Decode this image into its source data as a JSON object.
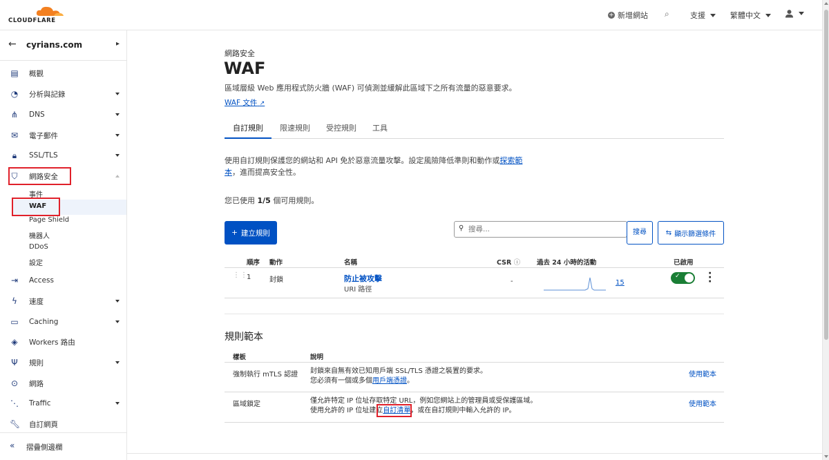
{
  "brand": {
    "logo_text": "CLOUDFLARE",
    "accent": "#f38020",
    "link_color": "#0051c3",
    "toggle_on": "#1a7e35"
  },
  "topbar": {
    "add_site": "新增網站",
    "support": "支援",
    "language": "繁體中文"
  },
  "sidebar": {
    "domain": "cyrians.com",
    "items": [
      {
        "label": "概觀",
        "icon": "document-icon"
      },
      {
        "label": "分析與記錄",
        "icon": "analytics-icon"
      },
      {
        "label": "DNS",
        "icon": "network-icon"
      },
      {
        "label": "電子郵件",
        "icon": "email-icon"
      },
      {
        "label": "SSL/TLS",
        "icon": "lock-icon"
      },
      {
        "label": "網路安全",
        "icon": "shield-icon"
      },
      {
        "label": "Access",
        "icon": "access-icon"
      },
      {
        "label": "速度",
        "icon": "bolt-icon"
      },
      {
        "label": "Caching",
        "icon": "drive-icon"
      },
      {
        "label": "Workers 路由",
        "icon": "workers-icon"
      },
      {
        "label": "規則",
        "icon": "rules-icon"
      },
      {
        "label": "網路",
        "icon": "location-icon"
      },
      {
        "label": "Traffic",
        "icon": "traffic-icon"
      },
      {
        "label": "自訂網頁",
        "icon": "wrench-icon"
      }
    ],
    "security_sub": [
      "事件",
      "WAF",
      "Page Shield",
      "機器人",
      "DDoS",
      "設定"
    ],
    "collapse": "摺疊側邊欄"
  },
  "page": {
    "eyebrow": "網路安全",
    "title": "WAF",
    "description": "區域層級 Web 應用程式防火牆 (WAF) 可偵測並緩解此區域下之所有流量的惡意要求。",
    "doc_link": "WAF 文件",
    "tabs": [
      "自訂規則",
      "限速規則",
      "受控規則",
      "工具"
    ],
    "intro_text": "使用自訂規則保護您的網站和 API 免於惡意流量攻擊。設定風險降低準則和動作或",
    "intro_link": "探索範本",
    "intro_suffix": "，進而提高安全性。",
    "usage_prefix": "您已使用",
    "usage_count": "1/5",
    "usage_suffix": "個可用規則。",
    "create_button": "建立規則",
    "search_placeholder": "搜尋...",
    "search_button": "搜尋",
    "filter_button": "顯示篩選條件"
  },
  "rules_table": {
    "headers": {
      "order": "順序",
      "action": "動作",
      "name": "名稱",
      "csr": "CSR",
      "activity": "過去 24 小時的活動",
      "enabled": "已啟用"
    },
    "rows": [
      {
        "order": "1",
        "action": "封鎖",
        "name": "防止被攻擊",
        "expression": "URI 路徑",
        "csr": "-",
        "activity_count": "15",
        "enabled": true
      }
    ]
  },
  "templates": {
    "title": "規則範本",
    "headers": {
      "template": "樣板",
      "description": "說明"
    },
    "rows": [
      {
        "name": "強制執行 mTLS 認證",
        "line1": "封鎖來自無有效已知用戶端 SSL/TLS 憑證之裝置的要求。",
        "line2_prefix": "您必須有一個或多個",
        "line2_link": "用戶端憑證",
        "line2_suffix": "。",
        "action": "使用範本"
      },
      {
        "name": "區域鎖定",
        "line1": "僅允許特定 IP 位址存取特定 URL，例如您網站上的管理員或受保護區域。",
        "line2_prefix": "使用允許的 IP 位址建立",
        "line2_link": "自訂清單",
        "line2_suffix": "，或在自訂規則中輸入允許的 IP。",
        "action": "使用範本"
      }
    ]
  }
}
